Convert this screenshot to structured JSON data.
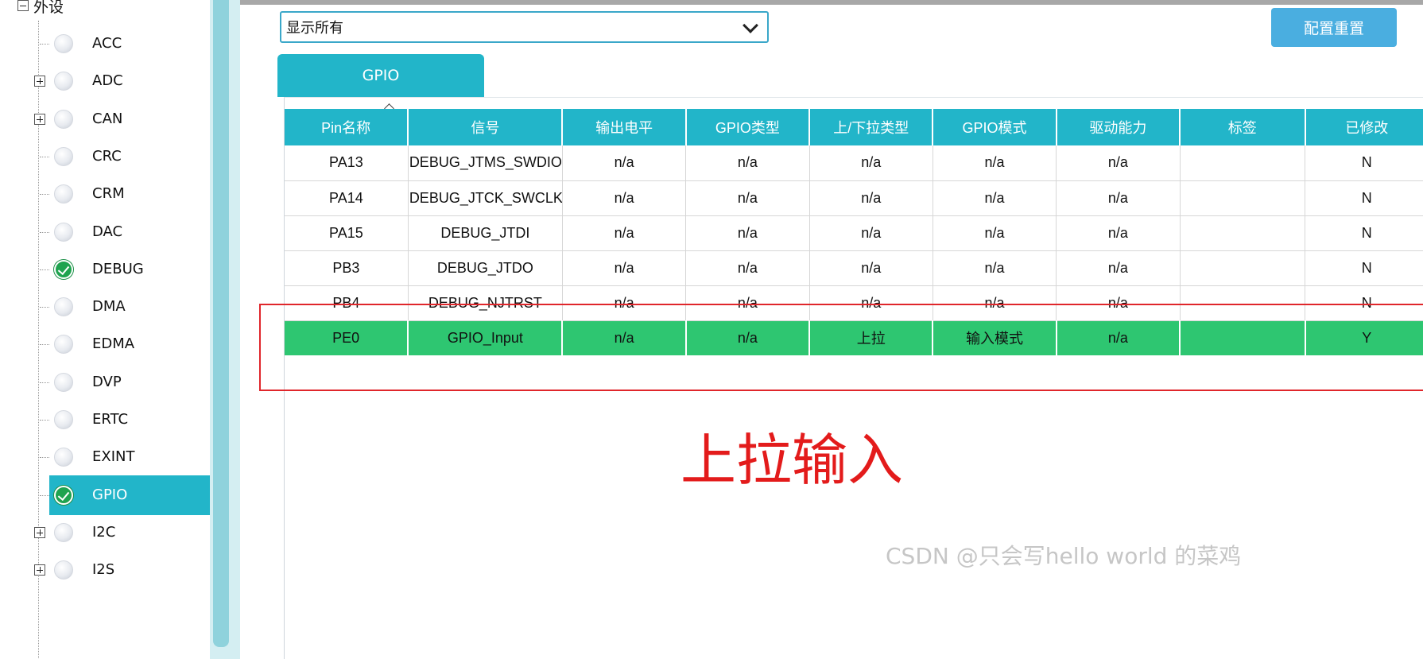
{
  "sidebar": {
    "group_label": "外设",
    "items": [
      {
        "label": "ACC",
        "expandable": false,
        "status": "idle"
      },
      {
        "label": "ADC",
        "expandable": true,
        "status": "idle"
      },
      {
        "label": "CAN",
        "expandable": true,
        "status": "idle"
      },
      {
        "label": "CRC",
        "expandable": false,
        "status": "idle"
      },
      {
        "label": "CRM",
        "expandable": false,
        "status": "idle"
      },
      {
        "label": "DAC",
        "expandable": false,
        "status": "idle"
      },
      {
        "label": "DEBUG",
        "expandable": false,
        "status": "configured"
      },
      {
        "label": "DMA",
        "expandable": false,
        "status": "idle"
      },
      {
        "label": "EDMA",
        "expandable": false,
        "status": "idle"
      },
      {
        "label": "DVP",
        "expandable": false,
        "status": "idle"
      },
      {
        "label": "ERTC",
        "expandable": false,
        "status": "idle"
      },
      {
        "label": "EXINT",
        "expandable": false,
        "status": "idle"
      },
      {
        "label": "GPIO",
        "expandable": false,
        "status": "configured",
        "selected": true
      },
      {
        "label": "I2C",
        "expandable": true,
        "status": "idle"
      },
      {
        "label": "I2S",
        "expandable": true,
        "status": "idle"
      }
    ]
  },
  "toolbar": {
    "filter_value": "显示所有",
    "reset_label": "配置重置"
  },
  "tabs": [
    {
      "label": "GPIO",
      "active": true
    }
  ],
  "table": {
    "headers": [
      "Pin名称",
      "信号",
      "输出电平",
      "GPIO类型",
      "上/下拉类型",
      "GPIO模式",
      "驱动能力",
      "标签",
      "已修改"
    ],
    "rows": [
      [
        "PA13",
        "DEBUG_JTMS_SWDIO",
        "n/a",
        "n/a",
        "n/a",
        "n/a",
        "n/a",
        "",
        "N"
      ],
      [
        "PA14",
        "DEBUG_JTCK_SWCLK",
        "n/a",
        "n/a",
        "n/a",
        "n/a",
        "n/a",
        "",
        "N"
      ],
      [
        "PA15",
        "DEBUG_JTDI",
        "n/a",
        "n/a",
        "n/a",
        "n/a",
        "n/a",
        "",
        "N"
      ],
      [
        "PB3",
        "DEBUG_JTDO",
        "n/a",
        "n/a",
        "n/a",
        "n/a",
        "n/a",
        "",
        "N"
      ],
      [
        "PB4",
        "DEBUG_NJTRST",
        "n/a",
        "n/a",
        "n/a",
        "n/a",
        "n/a",
        "",
        "N"
      ],
      [
        "PE0",
        "GPIO_Input",
        "n/a",
        "n/a",
        "上拉",
        "输入模式",
        "n/a",
        "",
        "Y"
      ]
    ],
    "highlighted_row_color": "#2ec671",
    "header_color": "#22b5c9"
  },
  "annotation": {
    "text": "上拉输入",
    "color": "#e31b1b"
  },
  "watermark": "CSDN @只会写hello world 的菜鸡"
}
